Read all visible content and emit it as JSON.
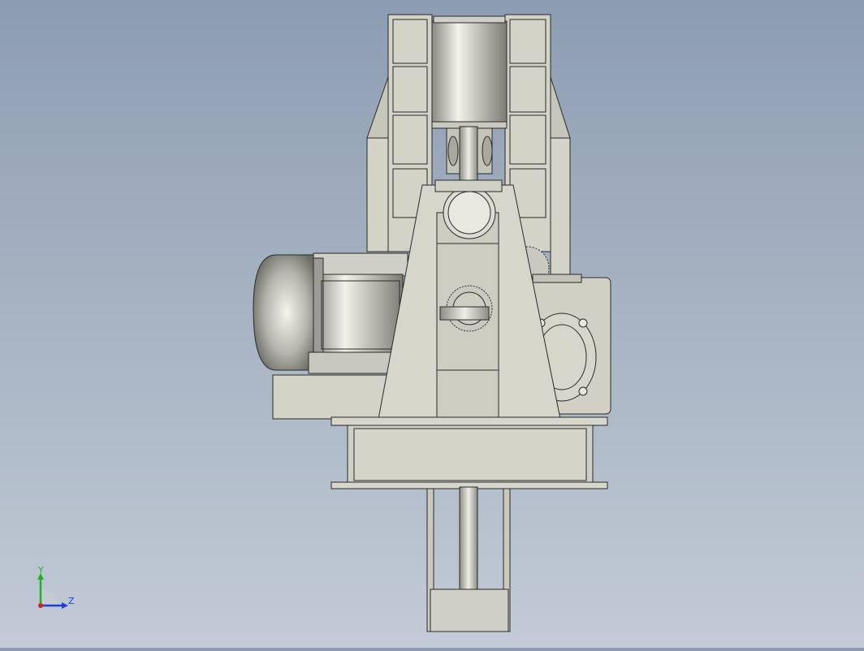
{
  "viewport": {
    "background_top": "#8d9db1",
    "background_bottom": "#c2cbd6",
    "model_fill": "#d3d3c8",
    "model_shade": "#b9b9ad",
    "edge_color": "#2a2a2a"
  },
  "triad": {
    "y_label": "Y",
    "z_label": "Z",
    "y_color": "#22b022",
    "z_color": "#1f3fd6",
    "x_color": "#d42020"
  }
}
